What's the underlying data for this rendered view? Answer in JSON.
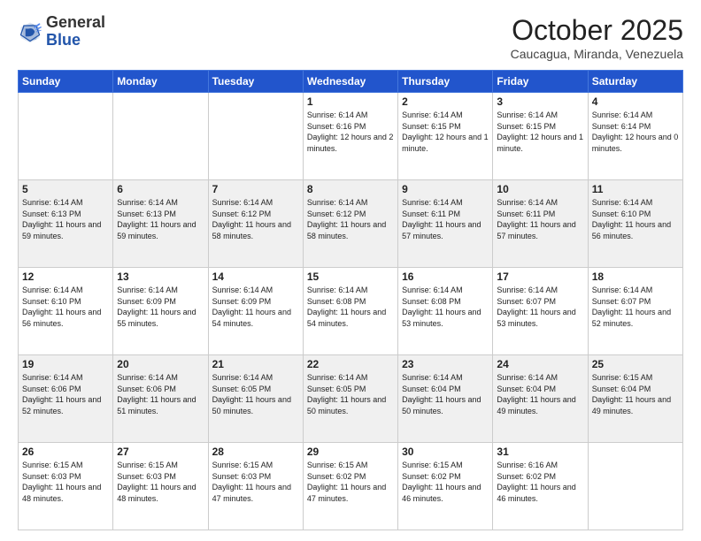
{
  "header": {
    "logo_general": "General",
    "logo_blue": "Blue",
    "month": "October 2025",
    "location": "Caucagua, Miranda, Venezuela"
  },
  "days_of_week": [
    "Sunday",
    "Monday",
    "Tuesday",
    "Wednesday",
    "Thursday",
    "Friday",
    "Saturday"
  ],
  "weeks": [
    [
      {
        "day": "",
        "text": ""
      },
      {
        "day": "",
        "text": ""
      },
      {
        "day": "",
        "text": ""
      },
      {
        "day": "1",
        "text": "Sunrise: 6:14 AM\nSunset: 6:16 PM\nDaylight: 12 hours\nand 2 minutes."
      },
      {
        "day": "2",
        "text": "Sunrise: 6:14 AM\nSunset: 6:15 PM\nDaylight: 12 hours\nand 1 minute."
      },
      {
        "day": "3",
        "text": "Sunrise: 6:14 AM\nSunset: 6:15 PM\nDaylight: 12 hours\nand 1 minute."
      },
      {
        "day": "4",
        "text": "Sunrise: 6:14 AM\nSunset: 6:14 PM\nDaylight: 12 hours\nand 0 minutes."
      }
    ],
    [
      {
        "day": "5",
        "text": "Sunrise: 6:14 AM\nSunset: 6:13 PM\nDaylight: 11 hours\nand 59 minutes."
      },
      {
        "day": "6",
        "text": "Sunrise: 6:14 AM\nSunset: 6:13 PM\nDaylight: 11 hours\nand 59 minutes."
      },
      {
        "day": "7",
        "text": "Sunrise: 6:14 AM\nSunset: 6:12 PM\nDaylight: 11 hours\nand 58 minutes."
      },
      {
        "day": "8",
        "text": "Sunrise: 6:14 AM\nSunset: 6:12 PM\nDaylight: 11 hours\nand 58 minutes."
      },
      {
        "day": "9",
        "text": "Sunrise: 6:14 AM\nSunset: 6:11 PM\nDaylight: 11 hours\nand 57 minutes."
      },
      {
        "day": "10",
        "text": "Sunrise: 6:14 AM\nSunset: 6:11 PM\nDaylight: 11 hours\nand 57 minutes."
      },
      {
        "day": "11",
        "text": "Sunrise: 6:14 AM\nSunset: 6:10 PM\nDaylight: 11 hours\nand 56 minutes."
      }
    ],
    [
      {
        "day": "12",
        "text": "Sunrise: 6:14 AM\nSunset: 6:10 PM\nDaylight: 11 hours\nand 56 minutes."
      },
      {
        "day": "13",
        "text": "Sunrise: 6:14 AM\nSunset: 6:09 PM\nDaylight: 11 hours\nand 55 minutes."
      },
      {
        "day": "14",
        "text": "Sunrise: 6:14 AM\nSunset: 6:09 PM\nDaylight: 11 hours\nand 54 minutes."
      },
      {
        "day": "15",
        "text": "Sunrise: 6:14 AM\nSunset: 6:08 PM\nDaylight: 11 hours\nand 54 minutes."
      },
      {
        "day": "16",
        "text": "Sunrise: 6:14 AM\nSunset: 6:08 PM\nDaylight: 11 hours\nand 53 minutes."
      },
      {
        "day": "17",
        "text": "Sunrise: 6:14 AM\nSunset: 6:07 PM\nDaylight: 11 hours\nand 53 minutes."
      },
      {
        "day": "18",
        "text": "Sunrise: 6:14 AM\nSunset: 6:07 PM\nDaylight: 11 hours\nand 52 minutes."
      }
    ],
    [
      {
        "day": "19",
        "text": "Sunrise: 6:14 AM\nSunset: 6:06 PM\nDaylight: 11 hours\nand 52 minutes."
      },
      {
        "day": "20",
        "text": "Sunrise: 6:14 AM\nSunset: 6:06 PM\nDaylight: 11 hours\nand 51 minutes."
      },
      {
        "day": "21",
        "text": "Sunrise: 6:14 AM\nSunset: 6:05 PM\nDaylight: 11 hours\nand 50 minutes."
      },
      {
        "day": "22",
        "text": "Sunrise: 6:14 AM\nSunset: 6:05 PM\nDaylight: 11 hours\nand 50 minutes."
      },
      {
        "day": "23",
        "text": "Sunrise: 6:14 AM\nSunset: 6:04 PM\nDaylight: 11 hours\nand 50 minutes."
      },
      {
        "day": "24",
        "text": "Sunrise: 6:14 AM\nSunset: 6:04 PM\nDaylight: 11 hours\nand 49 minutes."
      },
      {
        "day": "25",
        "text": "Sunrise: 6:15 AM\nSunset: 6:04 PM\nDaylight: 11 hours\nand 49 minutes."
      }
    ],
    [
      {
        "day": "26",
        "text": "Sunrise: 6:15 AM\nSunset: 6:03 PM\nDaylight: 11 hours\nand 48 minutes."
      },
      {
        "day": "27",
        "text": "Sunrise: 6:15 AM\nSunset: 6:03 PM\nDaylight: 11 hours\nand 48 minutes."
      },
      {
        "day": "28",
        "text": "Sunrise: 6:15 AM\nSunset: 6:03 PM\nDaylight: 11 hours\nand 47 minutes."
      },
      {
        "day": "29",
        "text": "Sunrise: 6:15 AM\nSunset: 6:02 PM\nDaylight: 11 hours\nand 47 minutes."
      },
      {
        "day": "30",
        "text": "Sunrise: 6:15 AM\nSunset: 6:02 PM\nDaylight: 11 hours\nand 46 minutes."
      },
      {
        "day": "31",
        "text": "Sunrise: 6:16 AM\nSunset: 6:02 PM\nDaylight: 11 hours\nand 46 minutes."
      },
      {
        "day": "",
        "text": ""
      }
    ]
  ]
}
